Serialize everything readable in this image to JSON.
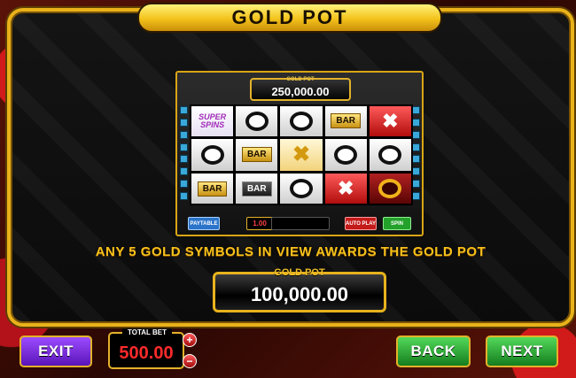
{
  "title": "GOLD POT",
  "machine": {
    "jackpot_label": "GOLD POT",
    "jackpot_value": "250,000.00",
    "reels": [
      [
        "super",
        "o",
        "o",
        "goldbar",
        "redx"
      ],
      [
        "o",
        "goldbar",
        "goldx",
        "o",
        "o"
      ],
      [
        "goldbar",
        "bar",
        "o",
        "redx",
        "redo"
      ]
    ],
    "super_text": "SUPER SPINS",
    "bar_text": "BAR",
    "paytable_label": "PAYTABLE",
    "bet_value": "1.00",
    "auto_label": "AUTO PLAY",
    "spin_label": "SPIN"
  },
  "rule_text": "ANY 5 GOLD SYMBOLS IN VIEW AWARDS THE GOLD POT",
  "gold_pot": {
    "label": "GOLD POT",
    "value": "100,000.00"
  },
  "controls": {
    "exit_label": "EXIT",
    "total_bet_label": "TOTAL BET",
    "total_bet_value": "500.00",
    "increase_symbol": "+",
    "decrease_symbol": "−",
    "back_label": "BACK",
    "next_label": "NEXT"
  },
  "colors": {
    "gold": "#e9b21a",
    "exit_button": "#7b2ee8",
    "nav_buttons": "#2aa835",
    "bet_text": "#ff2a2a"
  }
}
